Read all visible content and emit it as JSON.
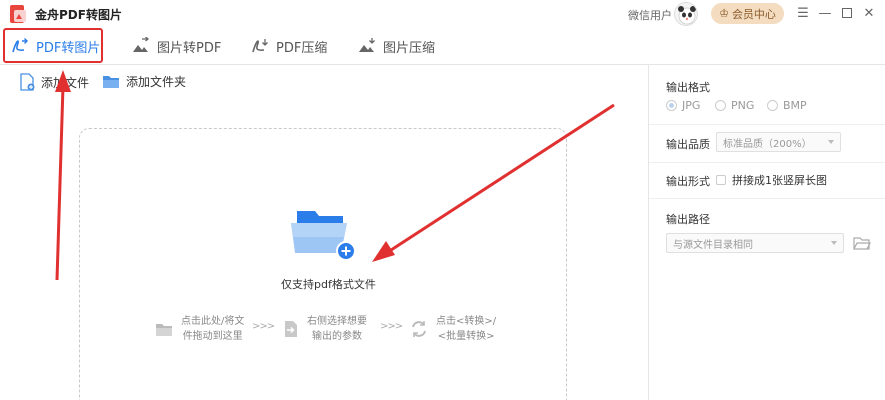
{
  "titlebar": {
    "app_title": "金舟PDF转图片",
    "user_label": "微信用户",
    "vip_label": "会员中心"
  },
  "tabs": [
    {
      "label": "PDF转图片",
      "active": true
    },
    {
      "label": "图片转PDF",
      "active": false
    },
    {
      "label": "PDF压缩",
      "active": false
    },
    {
      "label": "图片压缩",
      "active": false
    }
  ],
  "toolbar": {
    "add_file": "添加文件",
    "add_folder": "添加文件夹"
  },
  "dropzone": {
    "hint": "仅支持pdf格式文件"
  },
  "steps": [
    {
      "line1": "点击此处/将文",
      "line2": "件拖动到这里"
    },
    {
      "line1": "右侧选择想要",
      "line2": "输出的参数"
    },
    {
      "line1": "点击<转换>/",
      "line2": "<批量转换>"
    }
  ],
  "step_arrow": ">>>",
  "settings": {
    "format_label": "输出格式",
    "formats": [
      {
        "label": "JPG",
        "selected": true
      },
      {
        "label": "PNG",
        "selected": false
      },
      {
        "label": "BMP",
        "selected": false
      }
    ],
    "quality_label": "输出品质",
    "quality_value": "标准品质（200%）",
    "form_label": "输出形式",
    "form_option": "拼接成1张竖屏长图",
    "path_label": "输出路径",
    "path_value": "与源文件目录相同"
  },
  "colors": {
    "accent": "#2b7de9",
    "annotation": "#e03030",
    "vip_bg": "#f3dcc0"
  }
}
